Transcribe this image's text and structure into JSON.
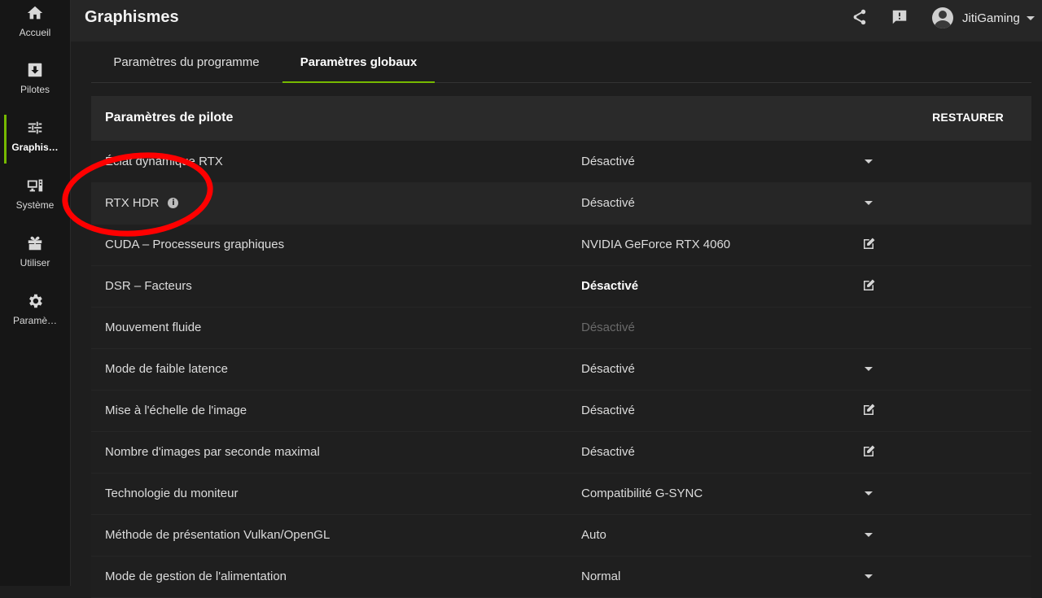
{
  "nav": [
    {
      "label": "Accueil",
      "icon": "home-icon"
    },
    {
      "label": "Pilotes",
      "icon": "download-icon"
    },
    {
      "label": "Graphis…",
      "icon": "sliders-icon",
      "active": true
    },
    {
      "label": "Système",
      "icon": "monitor-icon"
    },
    {
      "label": "Utiliser",
      "icon": "gift-icon"
    },
    {
      "label": "Paramè…",
      "icon": "gear-icon"
    }
  ],
  "header": {
    "title": "Graphismes",
    "username": "JitiGaming"
  },
  "tabs": [
    {
      "label": "Paramètres du programme",
      "active": false
    },
    {
      "label": "Paramètres globaux",
      "active": true
    }
  ],
  "panel": {
    "title": "Paramètres de pilote",
    "restore_label": "RESTAURER",
    "rows": [
      {
        "name": "Éclat dynamique RTX",
        "value": "Désactivé",
        "control": "dropdown"
      },
      {
        "name": "RTX HDR",
        "value": "Désactivé",
        "control": "dropdown",
        "info": true
      },
      {
        "name": "CUDA – Processeurs graphiques",
        "value": "NVIDIA GeForce RTX 4060",
        "control": "edit"
      },
      {
        "name": "DSR – Facteurs",
        "value": "Désactivé",
        "control": "edit",
        "bold": true
      },
      {
        "name": "Mouvement fluide",
        "value": "Désactivé",
        "control": "none",
        "disabled": true
      },
      {
        "name": "Mode de faible latence",
        "value": "Désactivé",
        "control": "dropdown"
      },
      {
        "name": "Mise à l'échelle de l'image",
        "value": "Désactivé",
        "control": "edit"
      },
      {
        "name": "Nombre d'images par seconde maximal",
        "value": "Désactivé",
        "control": "edit"
      },
      {
        "name": "Technologie du moniteur",
        "value": "Compatibilité G-SYNC",
        "control": "dropdown"
      },
      {
        "name": "Méthode de présentation Vulkan/OpenGL",
        "value": "Auto",
        "control": "dropdown"
      },
      {
        "name": "Mode de gestion de l'alimentation",
        "value": "Normal",
        "control": "dropdown"
      }
    ]
  },
  "colors": {
    "accent": "#76b900",
    "annotation": "#ff0000",
    "background": "#1e1e1e"
  }
}
